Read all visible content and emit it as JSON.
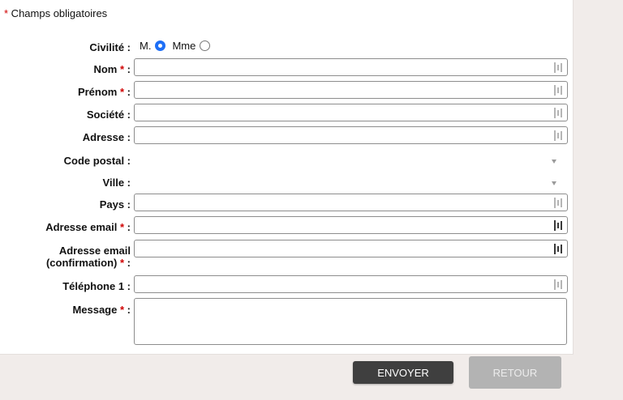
{
  "required_note": {
    "star": "*",
    "text": " Champs obligatoires"
  },
  "form": {
    "civility": {
      "label": "Civilité :",
      "options": [
        {
          "label": "M.",
          "selected": true
        },
        {
          "label": "Mme",
          "selected": false
        }
      ]
    },
    "fields": {
      "nom": {
        "label": "Nom",
        "required": "*",
        "colon": " :",
        "value": ""
      },
      "prenom": {
        "label": "Prénom",
        "required": "*",
        "colon": " :",
        "value": ""
      },
      "societe": {
        "label": "Société :",
        "value": ""
      },
      "adresse": {
        "label": "Adresse :",
        "value": ""
      },
      "code_postal": {
        "label": "Code postal :",
        "value": ""
      },
      "ville": {
        "label": "Ville :",
        "value": ""
      },
      "pays": {
        "label": "Pays :",
        "value": ""
      },
      "email": {
        "label": "Adresse email",
        "required": "*",
        "colon": " :",
        "value": ""
      },
      "email_confirm": {
        "label_line1": "Adresse email",
        "label_line2": "(confirmation)",
        "required": "*",
        "colon": " :",
        "value": ""
      },
      "telephone": {
        "label": "Téléphone 1 :",
        "value": ""
      },
      "message": {
        "label": "Message",
        "required": "*",
        "colon": " :",
        "value": ""
      }
    }
  },
  "buttons": {
    "send": "ENVOYER",
    "back": "RETOUR"
  },
  "colors": {
    "required_star": "#d00000",
    "send_bg": "#3f3f3f",
    "back_bg": "#b3b3b3",
    "radio_selected": "#1e6ff6"
  },
  "icons": {
    "password_manager": "password-manager-icon",
    "dropdown": "chevron-down-icon"
  }
}
